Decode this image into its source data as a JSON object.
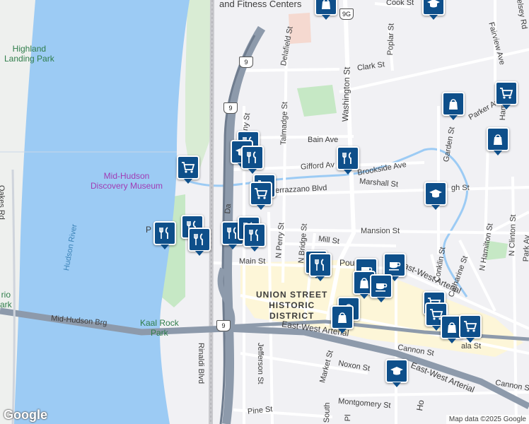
{
  "map": {
    "colors": {
      "water": "#9ccbf4",
      "land": "#f1f1f4",
      "park": "#c6e8c5",
      "road": "#ffffff",
      "highway": "#8d9aab",
      "district": "#fdf6d8",
      "pin": "#0e4f8a"
    },
    "labels": {
      "fitness": "and Fitness Centers",
      "highland_park_1": "Highland",
      "highland_park_2": "Landing Park",
      "museum_1": "Mid-Hudson",
      "museum_2": "Discovery Museum",
      "oakes_rd": "Oakes Rd",
      "hudson_river": "Hudson River",
      "rio_1": "rio",
      "rio_2": "ark",
      "brg": "Mid-Hudson Brg",
      "kaal_1": "Kaal Rock",
      "kaal_2": "Park",
      "rinaldi": "Rinaldi Blvd",
      "jefferson": "Jefferson St",
      "market": "Market St",
      "noxon": "Noxon St",
      "cannon1": "Cannon St",
      "cannon2": "Cannon St",
      "montgomery": "Montgomery St",
      "pine": "Pine St",
      "eastwest1": "East-West Arterial",
      "eastwest2": "East-West Arterial",
      "eastwest3": "East-West Arterial",
      "union_1": "UNION STREET",
      "union_2": "HISTORIC",
      "union_3": "DISTRICT",
      "main": "Main St",
      "mill": "Mill St",
      "mansion": "Mansion St",
      "nperry": "N Perry St",
      "nbridge": "N Bridge St",
      "marshall": "Marshall St",
      "gifford": "Gifford Av",
      "verrazzano": "errazzano Blvd",
      "brookside": "Brookside Ave",
      "bain": "Bain Ave",
      "talmadge": "Talmadge St",
      "delafield": "Delafield St",
      "washington": "Washington St",
      "clark": "Clark St",
      "poplar": "Poplar St",
      "cook": "Cook St",
      "fairview": "Fairview Ave",
      "parker": "Parker Ave",
      "garden": "Garden St",
      "conklin": "Conklin St",
      "catharine": "Catharine St",
      "nhamilton": "N Hamilton St",
      "nclinton": "N Clinton St",
      "park_ave": "Park Av",
      "hamilton_short": "Hamilt",
      "gh_st": "gh St",
      "ala_st": "ala St",
      "any_st": "any St",
      "pough": "Pough",
      "da": "Da",
      "p_frag": "P",
      "hols": "Ho",
      "south": "South",
      "pl": "Pl",
      "elsey": "elsey Rd",
      "s_9": "9",
      "s_9b": "9",
      "s_9g": "9G",
      "s_9c": "9"
    },
    "pins": [
      {
        "icon": "shopping-bag-icon"
      },
      {
        "icon": "graduation-cap-icon"
      },
      {
        "icon": "shopping-bag-icon"
      },
      {
        "icon": "shopping-cart-icon"
      },
      {
        "icon": "shopping-bag-icon"
      },
      {
        "icon": "shopping-cart-icon"
      },
      {
        "icon": "restaurant-icon"
      },
      {
        "icon": "graduation-cap-icon"
      },
      {
        "icon": "restaurant-icon"
      },
      {
        "icon": "restaurant-icon"
      },
      {
        "icon": "shopping-cart-icon"
      },
      {
        "icon": "shopping-cart-icon"
      },
      {
        "icon": "graduation-cap-icon"
      },
      {
        "icon": "restaurant-icon"
      },
      {
        "icon": "restaurant-icon"
      },
      {
        "icon": "restaurant-icon"
      },
      {
        "icon": "restaurant-icon"
      },
      {
        "icon": "restaurant-icon"
      },
      {
        "icon": "restaurant-icon"
      },
      {
        "icon": "restaurant-icon"
      },
      {
        "icon": "restaurant-icon"
      },
      {
        "icon": "coffee-icon"
      },
      {
        "icon": "coffee-icon"
      },
      {
        "icon": "shopping-bag-icon"
      },
      {
        "icon": "coffee-icon"
      },
      {
        "icon": "shopping-bag-icon"
      },
      {
        "icon": "shopping-bag-icon"
      },
      {
        "icon": "shopping-cart-icon"
      },
      {
        "icon": "shopping-cart-icon"
      },
      {
        "icon": "shopping-bag-icon"
      },
      {
        "icon": "shopping-cart-icon"
      },
      {
        "icon": "graduation-cap-icon"
      }
    ]
  },
  "footer": {
    "logo": "Google",
    "attribution": "Map data ©2025 Google"
  }
}
